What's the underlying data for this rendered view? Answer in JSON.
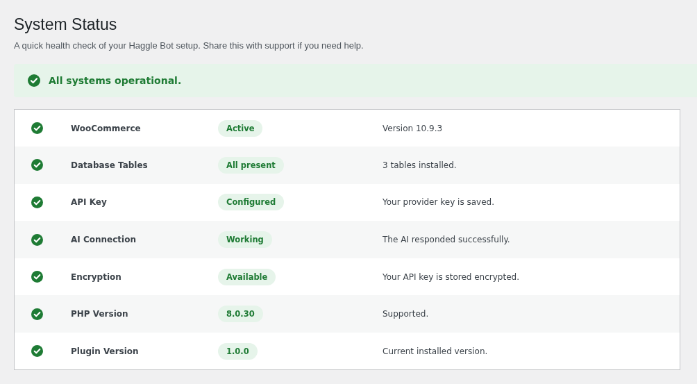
{
  "title": "System Status",
  "subtitle": "A quick health check of your Haggle Bot setup. Share this with support if you need help.",
  "banner": {
    "message": "All systems operational."
  },
  "checks": [
    {
      "name": "WooCommerce",
      "badge": "Active",
      "detail": "Version 10.9.3"
    },
    {
      "name": "Database Tables",
      "badge": "All present",
      "detail": "3 tables installed."
    },
    {
      "name": "API Key",
      "badge": "Configured",
      "detail": "Your provider key is saved."
    },
    {
      "name": "AI Connection",
      "badge": "Working",
      "detail": "The AI responded successfully."
    },
    {
      "name": "Encryption",
      "badge": "Available",
      "detail": "Your API key is stored encrypted."
    },
    {
      "name": "PHP Version",
      "badge": "8.0.30",
      "detail": "Supported."
    },
    {
      "name": "Plugin Version",
      "badge": "1.0.0",
      "detail": "Current installed version."
    }
  ]
}
